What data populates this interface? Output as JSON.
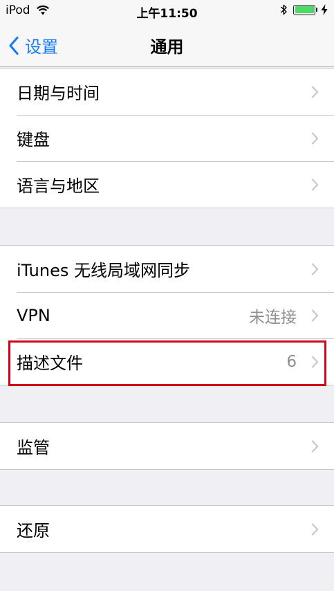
{
  "status_bar": {
    "carrier": "iPod",
    "time": "上午11:50",
    "wifi_icon": "wifi-icon",
    "bluetooth_icon": "bluetooth-icon",
    "battery_icon": "battery-icon",
    "battery_level": 1.0,
    "battery_color": "#4cd964"
  },
  "nav": {
    "back_label": "设置",
    "title": "通用",
    "accent_color": "#1a7cf5"
  },
  "groups": [
    {
      "cells": [
        {
          "label": "日期与时间",
          "detail": ""
        },
        {
          "label": "键盘",
          "detail": ""
        },
        {
          "label": "语言与地区",
          "detail": ""
        }
      ]
    },
    {
      "cells": [
        {
          "label": "iTunes 无线局域网同步",
          "detail": ""
        },
        {
          "label": "VPN",
          "detail": "未连接"
        },
        {
          "label": "描述文件",
          "detail": "6"
        }
      ]
    },
    {
      "cells": [
        {
          "label": "监管",
          "detail": ""
        }
      ]
    },
    {
      "cells": [
        {
          "label": "还原",
          "detail": ""
        }
      ]
    }
  ],
  "highlight": {
    "target": "描述文件",
    "color": "#d0021b"
  }
}
